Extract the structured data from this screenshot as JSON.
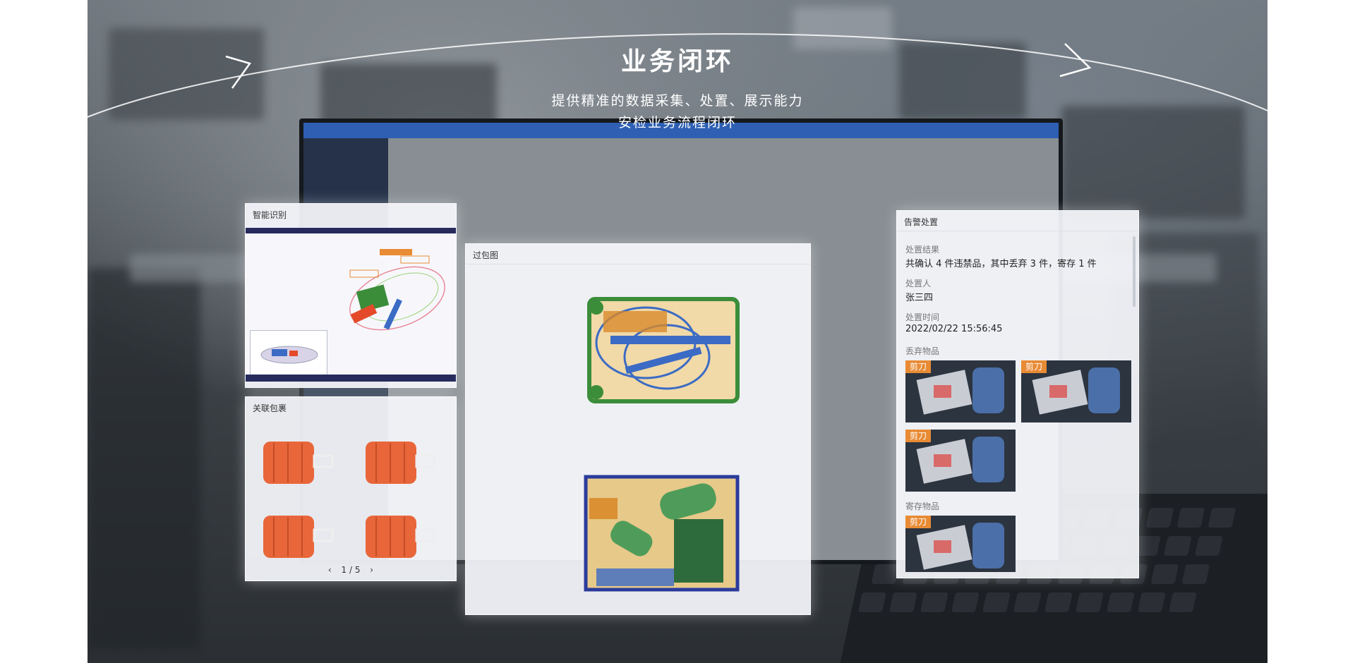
{
  "hero": {
    "title": "业务闭环",
    "subtitle_line1": "提供精准的数据采集、处置、展示能力",
    "subtitle_line2": "安检业务流程闭环"
  },
  "panels": {
    "smart_recognition": {
      "title": "智能识别"
    },
    "related_bags": {
      "title": "关联包裹",
      "pager": "1 / 5",
      "prev_icon": "chevron-left-icon",
      "next_icon": "chevron-right-icon"
    },
    "xray_image": {
      "title": "过包图"
    },
    "alarm_handling": {
      "title": "告警处置",
      "result_label": "处置结果",
      "result_value": "共确认 4 件违禁品，其中丢弃 3 件，寄存 1 件",
      "handler_label": "处置人",
      "handler_value": "张三四",
      "time_label": "处置时间",
      "time_value": "2022/02/22 15:56:45",
      "discarded_label": "丢弃物品",
      "discarded_items": [
        {
          "badge": "剪刀"
        },
        {
          "badge": "剪刀"
        },
        {
          "badge": "剪刀"
        }
      ],
      "deposited_label": "寄存物品",
      "deposited_items": [
        {
          "badge": "剪刀"
        }
      ]
    }
  },
  "colors": {
    "accent_orange": "#e88b34",
    "nav_dark": "#262b5c",
    "bag_orange": "#e8663a"
  }
}
